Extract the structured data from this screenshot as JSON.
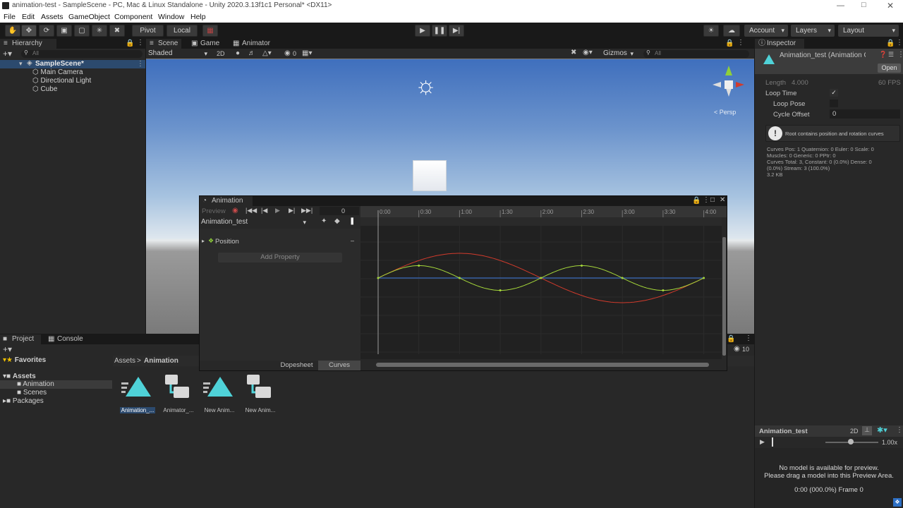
{
  "window_title": "animation-test - SampleScene - PC, Mac & Linux Standalone - Unity 2020.3.13f1c1 Personal* <DX11>",
  "menu": [
    "File",
    "Edit",
    "Assets",
    "GameObject",
    "Component",
    "Window",
    "Help"
  ],
  "toolbar": {
    "pivot": "Pivot",
    "local": "Local",
    "account": "Account",
    "layers": "Layers",
    "layout": "Layout"
  },
  "hierarchy": {
    "tab": "Hierarchy",
    "search_placeholder": "All",
    "scene": "SampleScene*",
    "items": [
      "Main Camera",
      "Directional Light",
      "Cube"
    ]
  },
  "scene_view": {
    "tabs": [
      "Scene",
      "Game",
      "Animator"
    ],
    "shading": "Shaded",
    "mode_2d": "2D",
    "hidden_count": "0",
    "gizmos": "Gizmos",
    "search_placeholder": "All",
    "persp": "< Persp"
  },
  "animation": {
    "tab": "Animation",
    "preview": "Preview",
    "frame": "0",
    "clip": "Animation_test",
    "property": "Position",
    "add_property": "Add Property",
    "ticks": [
      "0:00",
      "0:30",
      "1:00",
      "1:30",
      "2:00",
      "2:30",
      "3:00",
      "3:30",
      "4:00"
    ],
    "dopesheet": "Dopesheet",
    "curves": "Curves",
    "curve_colors": {
      "x": "#d23b2c",
      "y": "#a6d83a",
      "z": "#3d7be0"
    }
  },
  "project": {
    "tabs": [
      "Project",
      "Console"
    ],
    "favorites": "Favorites",
    "assets": "Assets",
    "folders": [
      "Animation",
      "Scenes"
    ],
    "packages": "Packages",
    "breadcrumb": [
      "Assets",
      "Animation"
    ],
    "hidden_count": "10",
    "files": [
      {
        "name": "Animation_...",
        "type": "anim"
      },
      {
        "name": "Animator_...",
        "type": "controller"
      },
      {
        "name": "New Anim...",
        "type": "anim"
      },
      {
        "name": "New Anim...",
        "type": "controller"
      }
    ]
  },
  "inspector": {
    "tab": "Inspector",
    "title": "Animation_test (Animation C",
    "open": "Open",
    "length_label": "Length",
    "length_value": "4.000",
    "fps": "60 FPS",
    "loop_time": "Loop Time",
    "loop_pose": "Loop Pose",
    "cycle_offset": "Cycle Offset",
    "cycle_offset_value": "0",
    "warning": "Root contains position and rotation curves",
    "stats": [
      "Curves Pos: 1 Quaternion: 0 Euler: 0 Scale: 0",
      "Muscles: 0 Generic: 0 PPtr: 0",
      "Curves Total: 3, Constant: 0 (0.0%) Dense: 0",
      "(0.0%) Stream: 3 (100.0%)",
      "3.2 KB"
    ],
    "preview_title": "Animation_test",
    "preview_2d": "2D",
    "speed": "1.00x",
    "no_model_1": "No model is available for preview.",
    "no_model_2": "Please drag a model into this Preview Area.",
    "time_readout": "0:00 (000.0%) Frame 0"
  }
}
